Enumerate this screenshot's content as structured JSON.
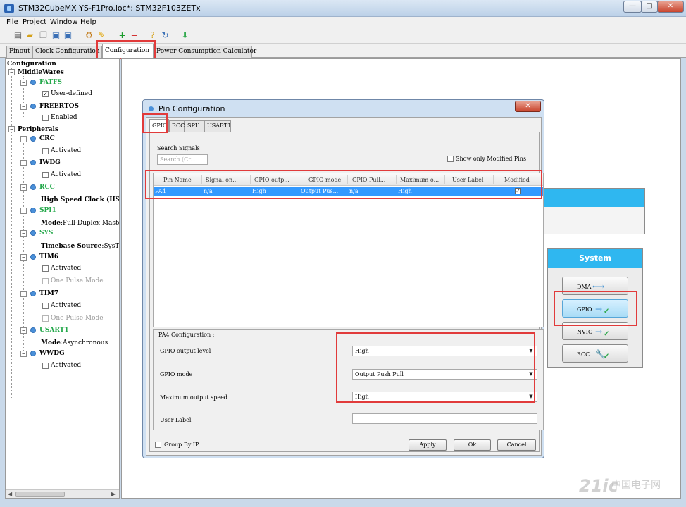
{
  "window": {
    "title": "STM32CubeMX YS-F1Pro.ioc*: STM32F103ZETx",
    "min_label": "—",
    "max_label": "□",
    "close_label": "✕"
  },
  "menu": [
    "File",
    "Project",
    "Window",
    "Help"
  ],
  "main_tabs": [
    "Pinout",
    "Clock Configuration",
    "Configuration",
    "Power Consumption Calculator"
  ],
  "tree": {
    "root": "Configuration",
    "middlewares": "MiddleWares",
    "fatfs": "FATFS",
    "fatfs_user": "User-defined",
    "freertos": "FREERTOS",
    "freertos_enabled": "Enabled",
    "peripherals": "Peripherals",
    "crc": "CRC",
    "crc_activated": "Activated",
    "iwdg": "IWDG",
    "iwdg_activated": "Activated",
    "rcc": "RCC",
    "rcc_hse_key": "High Speed Clock (HS",
    "spi1": "SPI1",
    "spi1_mode_key": "Mode",
    "spi1_mode_val": ":Full-Duplex Maste",
    "sys": "SYS",
    "sys_timebase_key": "Timebase Source",
    "sys_timebase_val": ":SysT",
    "tim6": "TIM6",
    "tim6_activated": "Activated",
    "tim6_onepulse": "One Pulse Mode",
    "tim7": "TIM7",
    "tim7_activated": "Activated",
    "tim7_onepulse": "One Pulse Mode",
    "usart1": "USART1",
    "usart1_mode_key": "Mode",
    "usart1_mode_val": ":Asynchronous",
    "wwdg": "WWDG",
    "wwdg_activated": "Activated"
  },
  "system_panel": {
    "title": "System",
    "buttons": [
      "DMA",
      "GPIO",
      "NVIC",
      "RCC"
    ]
  },
  "dialog": {
    "title": "Pin Configuration",
    "close_label": "✕",
    "tabs": [
      "GPIO",
      "RCC",
      "SPI1",
      "USART1"
    ],
    "search_label": "Search Signals",
    "search_placeholder": "Search (Cr...",
    "show_modified": "Show only Modified Pins",
    "columns": [
      "Pin Name",
      "Signal on...",
      "GPIO outp...",
      "GPIO mode",
      "GPIO Pull...",
      "Maximum o...",
      "User Label",
      "Modified"
    ],
    "row": {
      "pin": "PA4",
      "signal": "n/a",
      "output": "High",
      "mode": "Output Pus...",
      "pull": "n/a",
      "speed": "High",
      "user_label": "",
      "modified": "✓"
    },
    "config_title": "PA4 Configuration :",
    "fields": {
      "output_level_label": "GPIO output level",
      "output_level_value": "High",
      "mode_label": "GPIO mode",
      "mode_value": "Output Push Pull",
      "speed_label": "Maximum output speed",
      "speed_value": "High",
      "user_label_label": "User Label"
    },
    "group_by_ip": "Group By IP",
    "apply": "Apply",
    "ok": "Ok",
    "cancel": "Cancel"
  },
  "watermark": {
    "logo": "21ic",
    "sub": "中国电子网"
  }
}
